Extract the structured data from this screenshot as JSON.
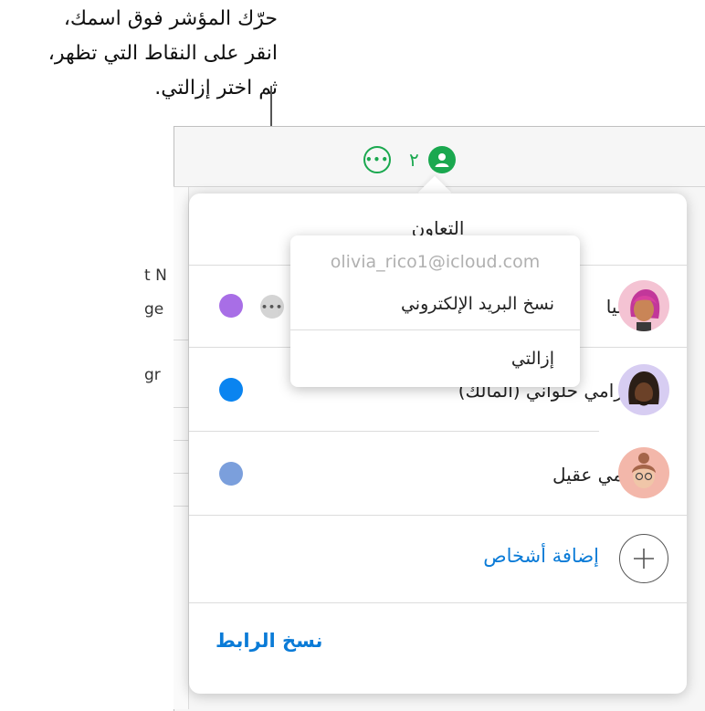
{
  "callout": {
    "line1": "حرّك المؤشر فوق اسمك،",
    "line2": "انقر على النقاط التي تظهر،",
    "line3": "ثم اختر إزالتي."
  },
  "toolbar": {
    "collaborator_count": "٢",
    "more_icon": "ellipsis-circle-icon",
    "collab_icon": "person-circle-icon",
    "accent_color": "#1aa84f"
  },
  "sheet_fragments": {
    "frag1": "t N",
    "frag2": "ge",
    "frag3": "gr"
  },
  "panel": {
    "title": "التعاون",
    "participants": [
      {
        "name": "ليا",
        "dot_color": "#a86ee6"
      },
      {
        "name": "رامي حلواني (المالك)",
        "dot_color": "#0a84f0"
      },
      {
        "name": "مي عقيل",
        "dot_color": "#7b9fdc"
      }
    ],
    "add_people_label": "إضافة أشخاص",
    "copy_link_label": "نسخ الرابط",
    "link_color": "#0a7bd7"
  },
  "popup": {
    "email": "olivia_rico1@icloud.com",
    "copy_email_label": "نسخ البريد الإلكتروني",
    "remove_label": "إزالتي"
  }
}
